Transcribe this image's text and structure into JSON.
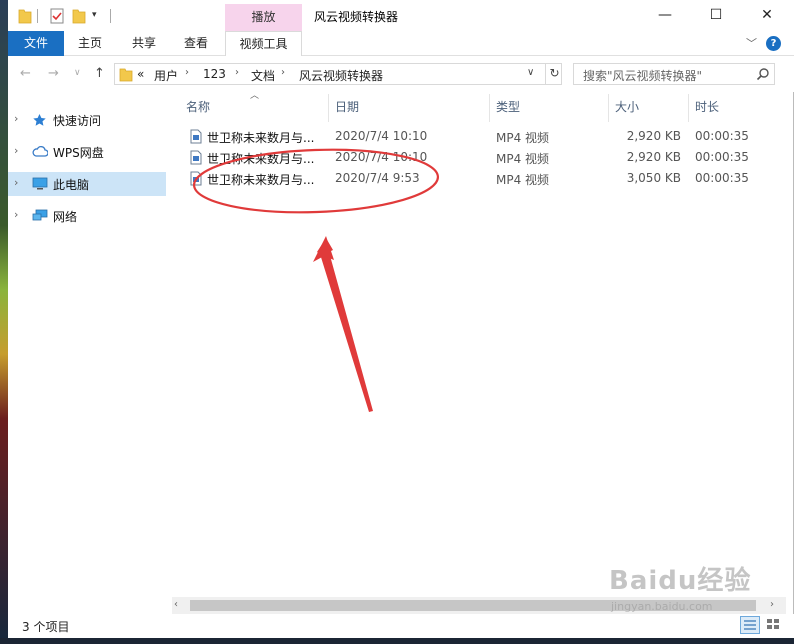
{
  "titlebar": {
    "title": "风云视频转换器",
    "context_tab_header": "播放",
    "buttons": {
      "minimize": "—",
      "maximize": "☐",
      "close": "✕"
    }
  },
  "ribbon": {
    "tabs": [
      {
        "label": "文件",
        "active": true
      },
      {
        "label": "主页"
      },
      {
        "label": "共享"
      },
      {
        "label": "查看"
      },
      {
        "label": "视频工具"
      }
    ],
    "accent": "#1a6fc2",
    "context_color": "#f7d4ec",
    "help": "?"
  },
  "navigation": {
    "breadcrumbs": [
      "«",
      "用户",
      "123",
      "文档",
      "风云视频转换器"
    ],
    "search_placeholder": "搜索\"风云视频转换器\""
  },
  "nav_pane": {
    "items": [
      {
        "label": "快速访问",
        "icon": "star-icon"
      },
      {
        "label": "WPS网盘",
        "icon": "cloud-icon"
      },
      {
        "label": "此电脑",
        "icon": "computer-icon",
        "selected": true
      },
      {
        "label": "网络",
        "icon": "network-icon"
      }
    ],
    "selected_color": "#cce4f7"
  },
  "file_list": {
    "columns": [
      "名称",
      "日期",
      "类型",
      "大小",
      "时长"
    ],
    "rows": [
      {
        "name": "世卫称未来数月与...",
        "date": "2020/7/4 10:10",
        "type": "MP4 视频",
        "size": "2,920 KB",
        "duration": "00:00:35"
      },
      {
        "name": "世卫称未来数月与...",
        "date": "2020/7/4 10:10",
        "type": "MP4 视频",
        "size": "2,920 KB",
        "duration": "00:00:35"
      },
      {
        "name": "世卫称未来数月与...",
        "date": "2020/7/4 9:53",
        "type": "MP4 视频",
        "size": "3,050 KB",
        "duration": "00:00:35"
      }
    ]
  },
  "annotation": {
    "color": "#e03a3a"
  },
  "status": {
    "item_count": "3 个项目"
  },
  "watermark": {
    "logo": "Baidu经验",
    "url": "jingyan.baidu.com"
  }
}
